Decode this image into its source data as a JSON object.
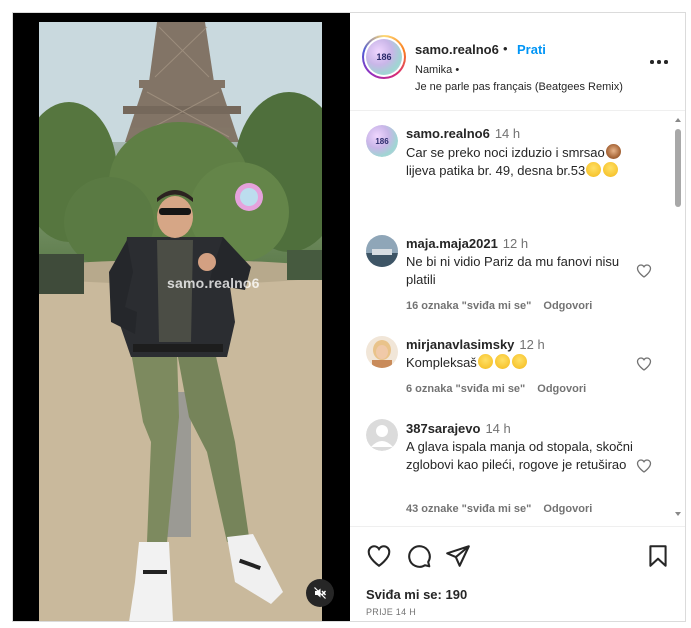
{
  "post": {
    "watermark": "samo.realno6",
    "mute_icon": "speaker-muted-icon"
  },
  "header": {
    "username": "samo.realno6",
    "separator": "•",
    "follow_label": "Prati",
    "line2": "Namika •",
    "line3": "Je ne parle pas français (Beatgees Remix)",
    "avatar_text": "186",
    "more_icon": "more-options-icon"
  },
  "comments": [
    {
      "username": "samo.realno6",
      "time": "14 h",
      "text_line1": "Car se preko noci izduzio i smrsao",
      "text_line2": "lijeva patika br. 49, desna br.53",
      "likes": "",
      "reply": ""
    },
    {
      "username": "maja.maja2021",
      "time": "12 h",
      "text": "Ne bi ni vidio Pariz da mu fanovi nisu platili",
      "likes": "16 oznaka \"sviđa mi se\"",
      "reply": "Odgovori"
    },
    {
      "username": "mirjanavlasimsky",
      "time": "12 h",
      "text": "Kompleksaš",
      "likes": "6 oznaka \"sviđa mi se\"",
      "reply": "Odgovori"
    },
    {
      "username": "387sarajevo",
      "time": "14 h",
      "text": "A glava ispala manja od stopala, skočni zglobovi kao pileći, rogove je retuširao",
      "likes": "43 oznake \"sviđa mi se\"",
      "reply": "Odgovori"
    }
  ],
  "actions": {
    "likes_label": "Sviđa mi se: 190",
    "posted_label": "PRIJE 14 H",
    "icons": [
      "heart-icon",
      "comment-icon",
      "share-icon",
      "bookmark-icon"
    ]
  },
  "colors": {
    "follow_blue": "#0095f6",
    "text_primary": "#262626",
    "text_secondary": "#737373",
    "border": "#dbdbdb"
  }
}
